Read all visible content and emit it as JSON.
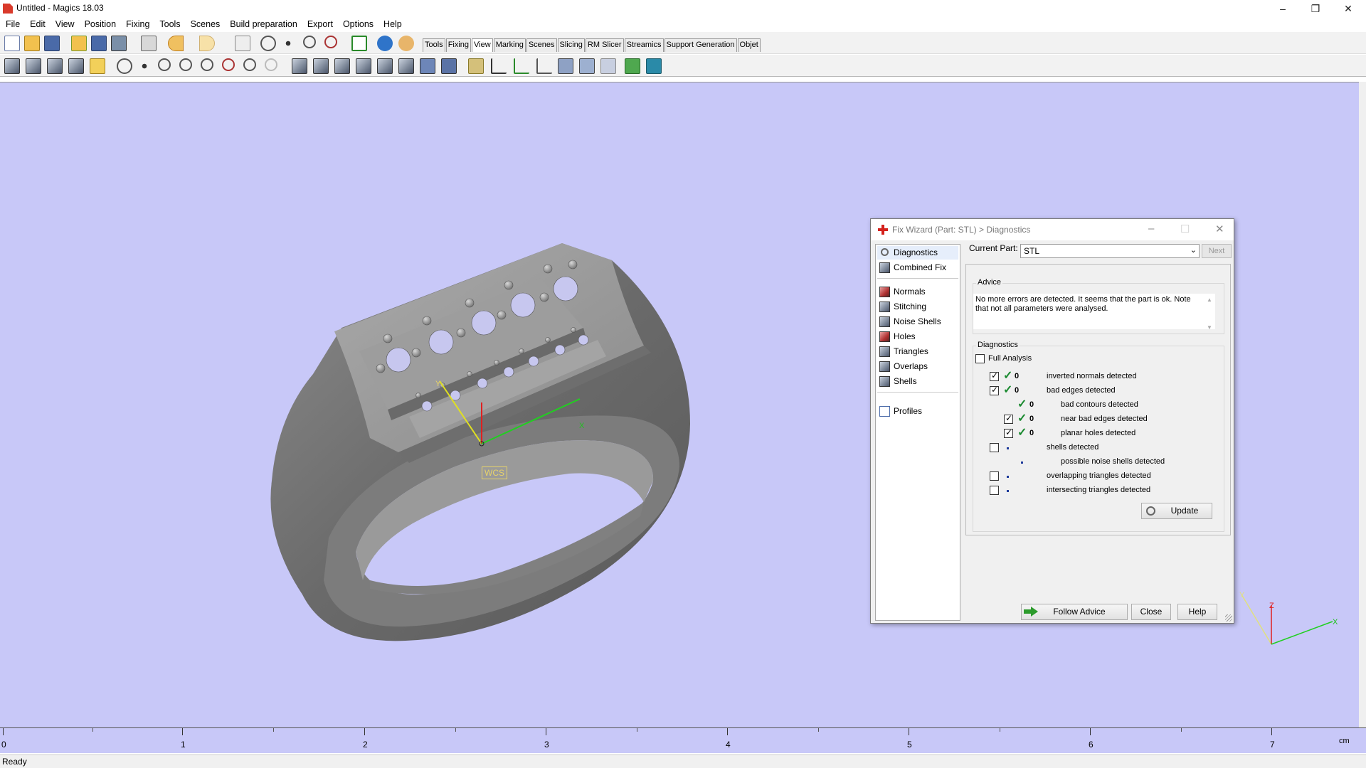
{
  "app": {
    "title": "Untitled - Magics 18.03"
  },
  "menu": [
    "File",
    "Edit",
    "View",
    "Position",
    "Fixing",
    "Tools",
    "Scenes",
    "Build preparation",
    "Export",
    "Options",
    "Help"
  ],
  "toolbar_tabs": [
    "Tools",
    "Fixing",
    "View",
    "Marking",
    "Scenes",
    "Slicing",
    "RM Slicer",
    "Streamics",
    "Support Generation",
    "Objet"
  ],
  "active_tab": "View",
  "viewport": {
    "wcs_label": "WCS",
    "axis_x": "X",
    "axis_y": "Y",
    "axis_z": "Z",
    "background": "#c8c8f8"
  },
  "ruler": {
    "labels": [
      "0",
      "1",
      "2",
      "3",
      "4",
      "5",
      "6",
      "7"
    ],
    "unit": "cm"
  },
  "status": {
    "text": "Ready"
  },
  "dialog": {
    "title": "Fix Wizard (Part: STL) > Diagnostics",
    "nav": {
      "top": [
        "Diagnostics",
        "Combined Fix"
      ],
      "middle": [
        "Normals",
        "Stitching",
        "Noise Shells",
        "Holes",
        "Triangles",
        "Overlaps",
        "Shells"
      ],
      "bottom": [
        "Profiles"
      ]
    },
    "current_part_label": "Current Part:",
    "current_part_value": "STL",
    "next_label": "Next",
    "advice": {
      "title": "Advice",
      "text": "No more errors are detected. It seems that the part is ok. Note that not all parameters were analysed."
    },
    "diagnostics": {
      "title": "Diagnostics",
      "full_analysis_label": "Full Analysis",
      "full_analysis_checked": false,
      "rows": [
        {
          "checked": true,
          "status": "ok",
          "count": "0",
          "label": "inverted normals detected"
        },
        {
          "checked": true,
          "status": "ok",
          "count": "0",
          "label": "bad edges detected"
        },
        {
          "checked": null,
          "status": "ok",
          "count": "0",
          "label": "bad contours detected"
        },
        {
          "checked": true,
          "status": "ok",
          "count": "0",
          "label": "near bad edges detected"
        },
        {
          "checked": true,
          "status": "ok",
          "count": "0",
          "label": "planar holes detected"
        },
        {
          "checked": false,
          "status": "none",
          "count": "",
          "label": "shells detected"
        },
        {
          "checked": null,
          "status": "none",
          "count": "",
          "label": "possible noise shells detected"
        },
        {
          "checked": false,
          "status": "none",
          "count": "",
          "label": "overlapping triangles detected"
        },
        {
          "checked": false,
          "status": "none",
          "count": "",
          "label": "intersecting triangles detected"
        }
      ],
      "update_label": "Update"
    },
    "footer": {
      "follow_advice": "Follow Advice",
      "close": "Close",
      "help": "Help"
    }
  }
}
